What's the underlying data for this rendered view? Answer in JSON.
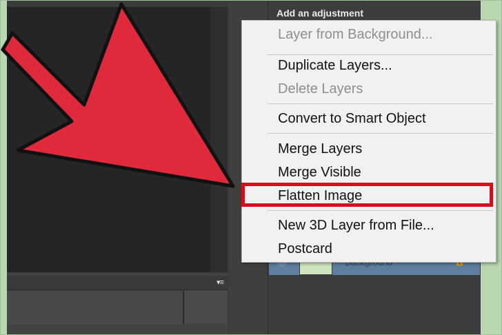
{
  "panel": {
    "title": "Add an adjustment"
  },
  "context_menu": {
    "items": [
      {
        "label": "Layer from Background...",
        "enabled": false
      },
      {
        "label": "Duplicate Layers...",
        "enabled": true
      },
      {
        "label": "Delete Layers",
        "enabled": false
      },
      {
        "label": "Convert to Smart Object",
        "enabled": true
      },
      {
        "label": "Merge Layers",
        "enabled": true
      },
      {
        "label": "Merge Visible",
        "enabled": true
      },
      {
        "label": "Flatten Image",
        "enabled": true,
        "highlighted": true
      },
      {
        "label": "New 3D Layer from File...",
        "enabled": true
      },
      {
        "label": "Postcard",
        "enabled": true
      }
    ]
  },
  "layers": {
    "background_layer_name": "Background"
  },
  "icons": {
    "panel_menu": "panel-menu-icon",
    "pointer": "red-arrow-pointer-icon",
    "eye": "visibility-eye-icon",
    "lock": "lock-icon"
  },
  "colors": {
    "highlight": "#d10f1f",
    "arrow": "#e02a3c",
    "selected_layer": "#5e7fa0"
  }
}
